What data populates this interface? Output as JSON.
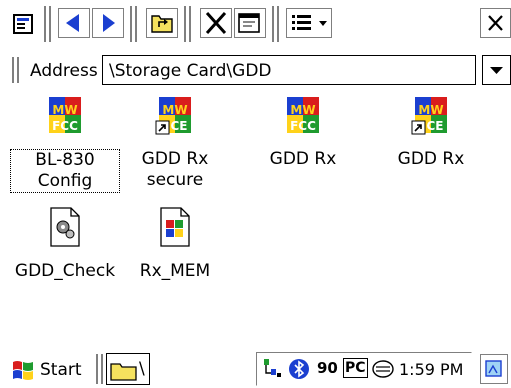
{
  "address_bar": {
    "label": "Address",
    "path": "\\Storage Card\\GDD"
  },
  "files": [
    {
      "label": "BL-830 Config",
      "icon": "mw-app-icon"
    },
    {
      "label": "GDD Rx\nsecure",
      "icon": "mw-shortcut-icon"
    },
    {
      "label": "GDD Rx",
      "icon": "mw-app-icon"
    },
    {
      "label": "GDD Rx",
      "icon": "mw-shortcut-icon"
    },
    {
      "label": "GDD_Check",
      "icon": "gear-document-icon"
    },
    {
      "label": "Rx_MEM",
      "icon": "windows-document-icon"
    }
  ],
  "taskbar": {
    "start_label": "Start",
    "window_label": "\\",
    "tray_pc_label": "PC",
    "tray_signal_label": "90",
    "clock": "1:59 PM"
  },
  "colors": {
    "folder_yellow": "#f5e25e",
    "icon_blue": "#1b3fd0",
    "icon_red": "#d91d1d",
    "icon_green": "#1f9b2f",
    "icon_yellow": "#ffd21a"
  }
}
